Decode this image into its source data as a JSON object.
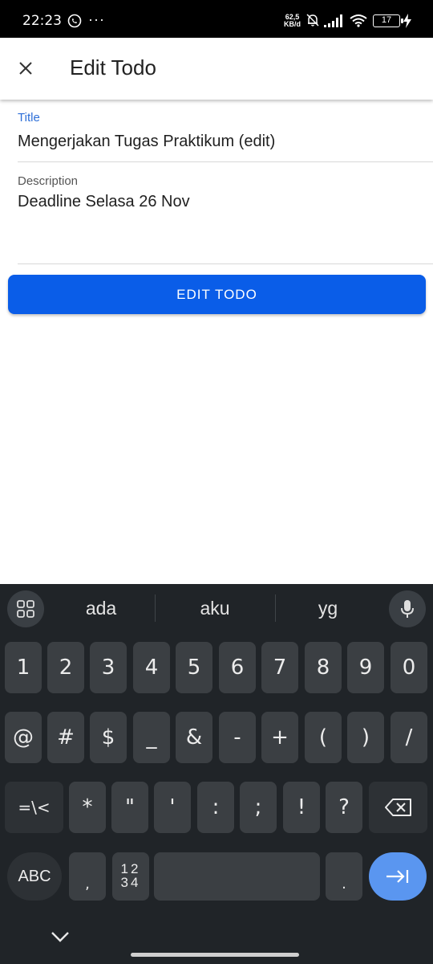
{
  "status_bar": {
    "time": "22:23",
    "more": "···",
    "net_speed_value": "62,5",
    "net_speed_unit": "KB/d",
    "battery": "17",
    "icons": [
      "whatsapp-icon",
      "bell-off-icon",
      "signal-icon",
      "wifi-icon",
      "battery-icon",
      "charging-icon"
    ]
  },
  "appbar": {
    "title": "Edit Todo",
    "close_icon": "close-icon"
  },
  "form": {
    "title_label": "Title",
    "title_value": "Mengerjakan Tugas Praktikum (edit)",
    "description_label": "Description",
    "description_value": "Deadline Selasa 26 Nov",
    "submit_label": "EDIT TODO"
  },
  "colors": {
    "primary": "#0a5de8",
    "focused_label": "#2e6fd8",
    "keyboard_bg": "#202428",
    "key_bg": "#3b3f43",
    "enter_key": "#5a96f0"
  },
  "keyboard": {
    "suggestions": [
      "ada",
      "aku",
      "yg"
    ],
    "row1": [
      "1",
      "2",
      "3",
      "4",
      "5",
      "6",
      "7",
      "8",
      "9",
      "0"
    ],
    "row2": [
      "@",
      "#",
      "$",
      "_",
      "&",
      "-",
      "+",
      "(",
      ")",
      "/"
    ],
    "row3_toggle": "=\\<",
    "row3": [
      "*",
      "\"",
      "'",
      ":",
      ";",
      "!",
      "?"
    ],
    "abc": "ABC",
    "comma": ",",
    "numpad_top": "12",
    "numpad_bottom": "34",
    "period": "."
  }
}
